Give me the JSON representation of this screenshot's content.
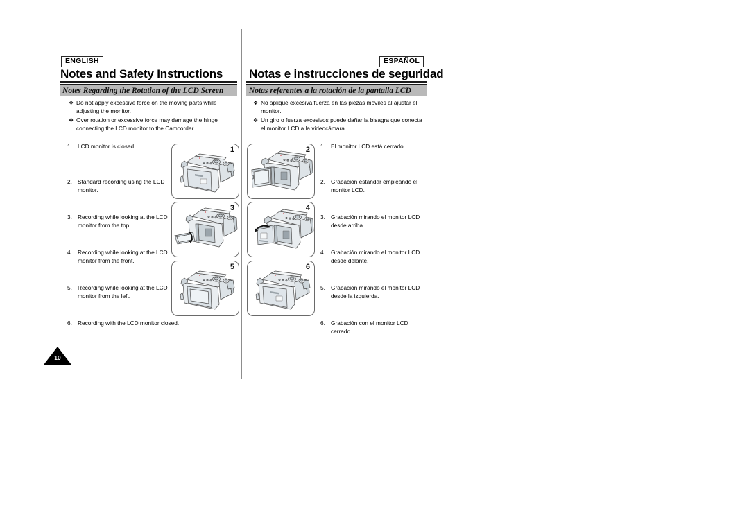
{
  "document": {
    "page_number": "10"
  },
  "columns": {
    "english": {
      "lang_tag": "ENGLISH",
      "chapter_title": "Notes and Safety Instructions",
      "section_title": "Notes Regarding the Rotation of the LCD Screen",
      "notes": [
        "Do not apply excessive force on the moving parts while adjusting the monitor.",
        "Over rotation or excessive force may damage the hinge connecting the LCD monitor to the Camcorder."
      ],
      "steps": [
        {
          "index": "1.",
          "text": "LCD monitor is closed."
        },
        {
          "index": "2.",
          "text": "Standard recording using the LCD monitor."
        },
        {
          "index": "3.",
          "text": "Recording while looking at the LCD monitor from the top."
        },
        {
          "index": "4.",
          "text": "Recording while looking at the LCD monitor from the front."
        },
        {
          "index": "5.",
          "text": "Recording while looking at the LCD monitor from the left."
        },
        {
          "index": "6.",
          "text": "Recording with the LCD monitor closed."
        }
      ]
    },
    "spanish": {
      "lang_tag": "ESPAÑOL",
      "chapter_title": "Notas e instrucciones de seguridad",
      "section_title": "Notas referentes a la rotación de la pantalla LCD",
      "notes": [
        "No apliqué excesiva fuerza en las piezas móviles al ajustar el monitor.",
        "Un giro o fuerza excesivos puede dañar la bisagra que conecta el monitor LCD a la videocámara."
      ],
      "steps": [
        {
          "index": "1.",
          "text": "El monitor LCD está cerrado."
        },
        {
          "index": "2.",
          "text": "Grabación estándar empleando el monitor LCD."
        },
        {
          "index": "3.",
          "text": "Grabación mirando el monitor LCD desde arriba."
        },
        {
          "index": "4.",
          "text": "Grabación mirando el monitor LCD desde delante."
        },
        {
          "index": "5.",
          "text": "Grabación mirando el monitor LCD desde la izquierda."
        },
        {
          "index": "6.",
          "text": "Grabación con el monitor LCD cerrado."
        }
      ]
    }
  },
  "bullet_glyph": "❖",
  "figures": [
    {
      "number": "1",
      "caption": "camcorder-lcd-closed"
    },
    {
      "number": "2",
      "caption": "camcorder-lcd-open-standard"
    },
    {
      "number": "3",
      "caption": "camcorder-lcd-rotated-from-top"
    },
    {
      "number": "4",
      "caption": "camcorder-lcd-rotated-from-front"
    },
    {
      "number": "5",
      "caption": "camcorder-lcd-facing-left"
    },
    {
      "number": "6",
      "caption": "camcorder-lcd-closed-outward"
    }
  ],
  "colors": {
    "section_bar": "#b9b9b9",
    "rule": "#1a1a1a",
    "divider": "#8d8d8d",
    "figure_border": "#6a6a6a",
    "body_shell_light": "#f2f4f5",
    "body_shell_mid": "#d5dade",
    "body_shell_dark": "#b2babf",
    "screen": "#e7edf1"
  }
}
